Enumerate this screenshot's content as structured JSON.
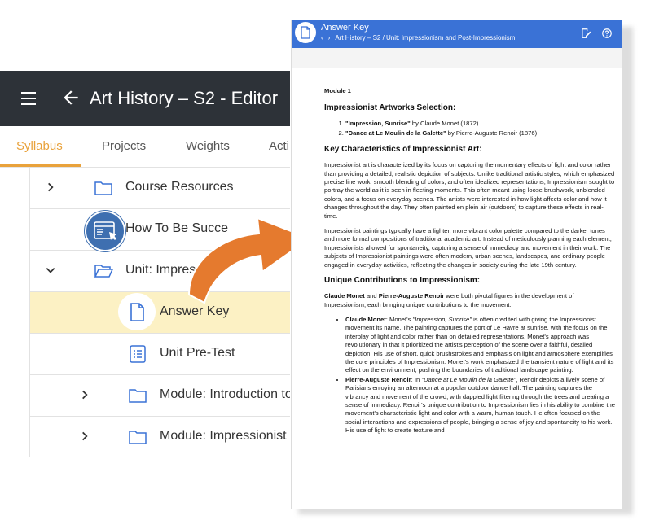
{
  "editor": {
    "title": "Art History – S2 - Editor",
    "tabs": [
      "Syllabus",
      "Projects",
      "Weights",
      "Acti"
    ],
    "rows": [
      {
        "label": "Course Resources"
      },
      {
        "label": "How To Be Succe"
      },
      {
        "label": "Unit: Impres"
      },
      {
        "label": "Answer Key"
      },
      {
        "label": "Unit Pre-Test"
      },
      {
        "label": "Module: Introduction to"
      },
      {
        "label": "Module: Impressionist"
      }
    ]
  },
  "doc": {
    "title": "Answer Key",
    "breadcrumb": "Art History – S2 / Unit: Impressionism and Post-Impressionism",
    "module": "Module 1",
    "h_selection": "Impressionist Artworks Selection:",
    "artworks": [
      {
        "title": "\"Impression, Sunrise\"",
        "rest": " by Claude Monet (1872)"
      },
      {
        "title": "\"Dance at Le Moulin de la Galette\"",
        "rest": " by Pierre-Auguste Renoir (1876)"
      }
    ],
    "h_characteristics": "Key Characteristics of Impressionist Art:",
    "para1": "Impressionist art is characterized by its focus on capturing the momentary effects of light and color rather than providing a detailed, realistic depiction of subjects. Unlike traditional artistic styles, which emphasized precise line work, smooth blending of colors, and often idealized representations, Impressionism sought to portray the world as it is seen in fleeting moments. This often meant using loose brushwork, unblended colors, and a focus on everyday scenes. The artists were interested in how light affects color and how it changes throughout the day. They often painted en plein air (outdoors) to capture these effects in real-time.",
    "para2": "Impressionist paintings typically have a lighter, more vibrant color palette compared to the darker tones and more formal compositions of traditional academic art. Instead of meticulously planning each element, Impressionists allowed for spontaneity, capturing a sense of immediacy and movement in their work. The subjects of Impressionist paintings were often modern, urban scenes, landscapes, and ordinary people engaged in everyday activities, reflecting the changes in society during the late 19th century.",
    "h_contributions": "Unique Contributions to Impressionism:",
    "para3_a": "Claude Monet",
    "para3_b": " and ",
    "para3_c": "Pierre-Auguste Renoir",
    "para3_d": " were both pivotal figures in the development of Impressionism, each bringing unique contributions to the movement.",
    "monet_name": "Claude Monet",
    "monet_pre": ": Monet's ",
    "monet_work": "\"Impression, Sunrise\"",
    "monet_text": " is often credited with giving the Impressionist movement its name. The painting captures the port of Le Havre at sunrise, with the focus on the interplay of light and color rather than on detailed representations. Monet's approach was revolutionary in that it prioritized the artist's perception of the scene over a faithful, detailed depiction. His use of short, quick brushstrokes and emphasis on light and atmosphere exemplifies the core principles of Impressionism. Monet's work emphasized the transient nature of light and its effect on the environment, pushing the boundaries of traditional landscape painting.",
    "renoir_name": "Pierre-Auguste Renoir",
    "renoir_pre": ": In ",
    "renoir_work": "\"Dance at Le Moulin de la Galette\"",
    "renoir_text": ", Renoir depicts a lively scene of Parisians enjoying an afternoon at a popular outdoor dance hall. The painting captures the vibrancy and movement of the crowd, with dappled light filtering through the trees and creating a sense of immediacy. Renoir's unique contribution to Impressionism lies in his ability to combine the movement's characteristic light and color with a warm, human touch. He often focused on the social interactions and expressions of people, bringing a sense of joy and spontaneity to his work. His use of light to create texture and"
  },
  "colors": {
    "accent_orange": "#e9a23b",
    "arrow": "#e57a2e",
    "doc_header": "#3a72d6",
    "editor_header": "#2d3238",
    "highlight": "#fcf1c4"
  },
  "icons": [
    "menu-icon",
    "back-arrow-icon",
    "chevron-right-icon",
    "chevron-down-icon",
    "folder-icon",
    "folder-open-icon",
    "document-icon",
    "checklist-icon",
    "web-page-icon",
    "edit-icon",
    "help-icon"
  ]
}
